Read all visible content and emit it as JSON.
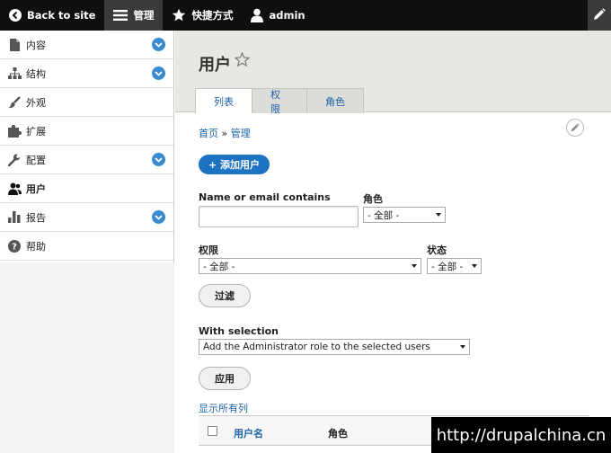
{
  "toolbar": {
    "back": "Back to site",
    "manage": "管理",
    "shortcuts": "快捷方式",
    "user": "admin"
  },
  "sidebar": {
    "items": [
      {
        "label": "内容",
        "icon": "file-icon",
        "expandable": true
      },
      {
        "label": "结构",
        "icon": "sitemap-icon",
        "expandable": true
      },
      {
        "label": "外观",
        "icon": "brush-icon",
        "expandable": false
      },
      {
        "label": "扩展",
        "icon": "puzzle-icon",
        "expandable": false
      },
      {
        "label": "配置",
        "icon": "wrench-icon",
        "expandable": true
      },
      {
        "label": "用户",
        "icon": "people-icon",
        "expandable": false,
        "active": true
      },
      {
        "label": "报告",
        "icon": "bar-chart-icon",
        "expandable": true
      },
      {
        "label": "帮助",
        "icon": "help-icon",
        "expandable": false
      }
    ]
  },
  "header": {
    "title": "用户",
    "tabs": [
      "列表",
      "权限",
      "角色"
    ]
  },
  "breadcrumb": {
    "home": "首页",
    "sep": "»",
    "manage": "管理"
  },
  "add_user": "+ 添加用户",
  "filters": {
    "name_label": "Name or email contains",
    "name_value": "",
    "role_label": "角色",
    "role_value": "- 全部 -",
    "perm_label": "权限",
    "perm_value": "- 全部 -",
    "status_label": "状态",
    "status_value": "- 全部 -",
    "filter_button": "过滤"
  },
  "bulk": {
    "label": "With selection",
    "value": "Add the Administrator role to the selected users",
    "apply_button": "应用"
  },
  "show_all_columns": "显示所有列",
  "table": {
    "headers": [
      "用户名",
      "角色"
    ]
  },
  "watermark": "http://drupalchina.cn",
  "colors": {
    "accent": "#1d72c2",
    "toolbar": "#0f0f0f",
    "link": "#1e62a8"
  }
}
